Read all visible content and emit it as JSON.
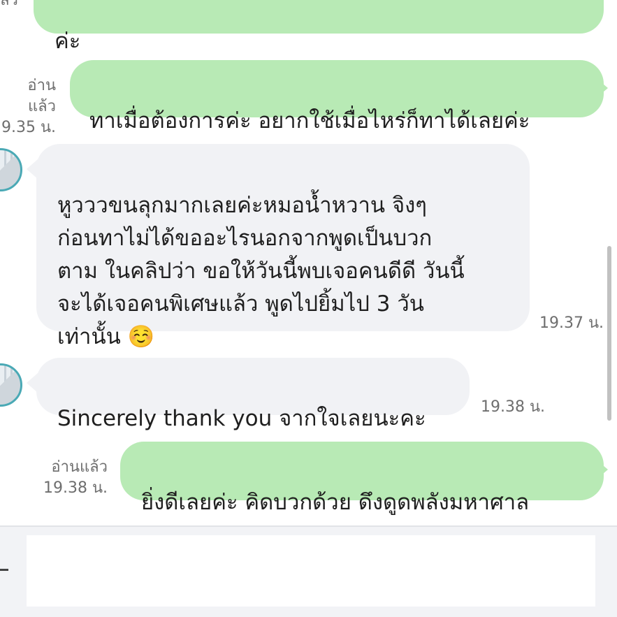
{
  "colors": {
    "outgoing_bubble": "#b8eab5",
    "incoming_bubble": "#f1f2f5",
    "meta_text": "#6e6e6e",
    "avatar_ring": "#4aa9b5"
  },
  "messages": [
    {
      "direction": "out",
      "text": "ค่ะ",
      "read_label": "ล้ว",
      "time": ""
    },
    {
      "direction": "out",
      "text": "ทาเมื่อต้องการค่ะ อยากใช้เมื่อไหร่ก็ทาได้เลยค่ะ",
      "read_label": "อ่านแล้ว",
      "time": "9.35 น."
    },
    {
      "direction": "in",
      "text": "หูวววขนลุกมากเลยค่ะหมอน้ำหวาน จิงๆ\nก่อนทาไม่ได้ขออะไรนอกจากพูดเป็นบวก\nตาม ในคลิปว่า ขอให้วันนี้พบเจอคนดีดี วันนี้\nจะได้เจอคนพิเศษแล้ว พูดไปยิ้มไป 3 วัน\nเท่านั้น ☺️",
      "time": "19.37 น."
    },
    {
      "direction": "in",
      "text": "Sincerely thank you จากใจเลยนะคะ",
      "time": "19.38 น."
    },
    {
      "direction": "out",
      "text": "ยิ่งดีเลยค่ะ คิดบวกด้วย ดึงดูดพลังมหาศาล",
      "read_label": "อ่านแล้ว",
      "time": "19.38 น."
    }
  ],
  "icons": {
    "avatar": "avatar-image",
    "input_left": "minus-icon"
  },
  "input": {
    "value": "",
    "placeholder": ""
  }
}
